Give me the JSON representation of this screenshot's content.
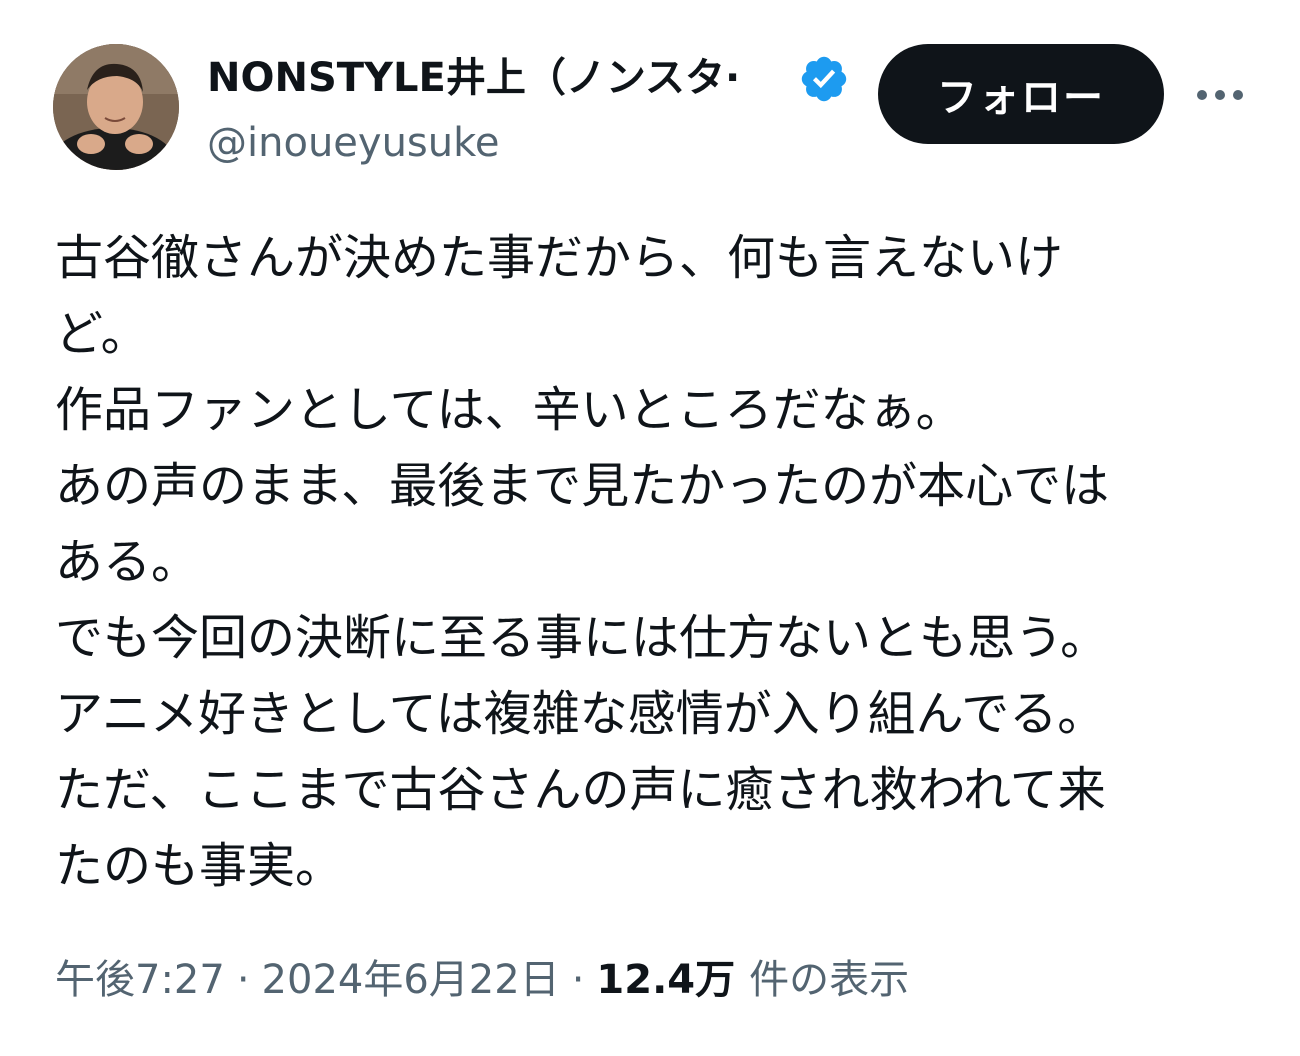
{
  "author": {
    "display_name": "NONSTYLE井上（ノンスタ·",
    "handle": "@inoueyusuke",
    "verified": true
  },
  "actions": {
    "follow_label": "フォロー"
  },
  "tweet": {
    "lines": [
      "古谷徹さんが決めた事だから、何も言えないけ",
      "ど。",
      "作品ファンとしては、辛いところだなぁ。",
      "あの声のまま、最後まで見たかったのが本心では",
      "ある。",
      "でも今回の決断に至る事には仕方ないとも思う。",
      "アニメ好きとしては複雑な感情が入り組んでる。",
      "ただ、ここまで古谷さんの声に癒され救われて来",
      "たのも事実。"
    ]
  },
  "meta": {
    "time": "午後7:27",
    "separator": "·",
    "date": "2024年6月22日",
    "views_count": "12.4万",
    "views_label": "件の表示"
  },
  "colors": {
    "text_primary": "#0f1419",
    "text_secondary": "#536471",
    "verified_blue": "#1d9bf0",
    "follow_bg": "#0f1419"
  }
}
